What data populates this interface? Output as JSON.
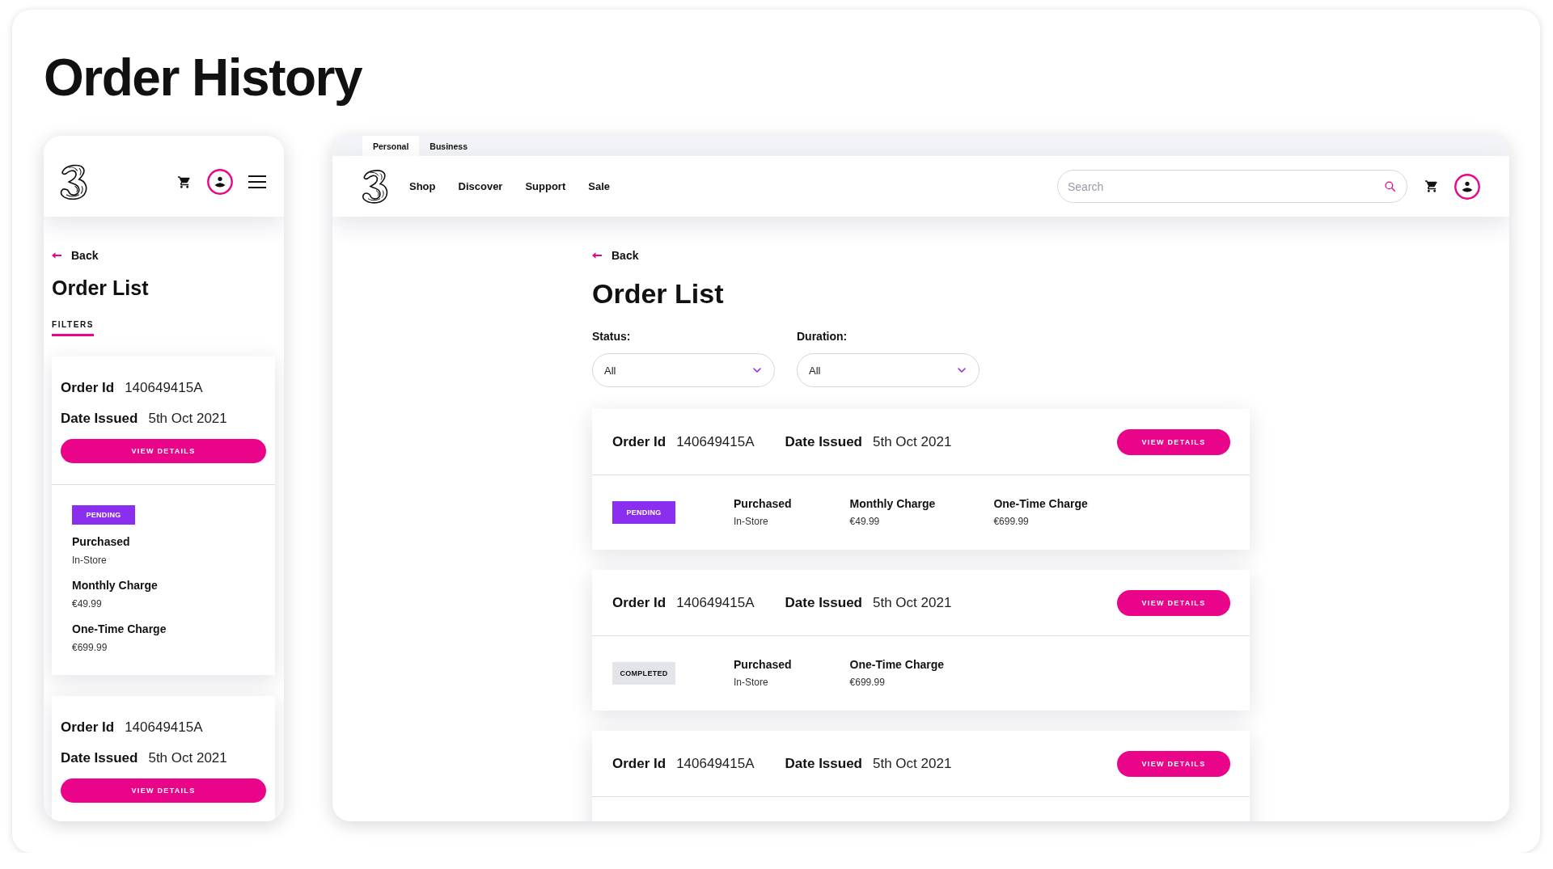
{
  "page_title": "Order History",
  "mobile_view": {
    "back_link": "Back",
    "heading": "Order List",
    "filters_toggle": "FILTERS",
    "orders": [
      {
        "order_id_label": "Order Id",
        "order_id": "140649415A",
        "date_label": "Date Issued",
        "date": "5th Oct 2021",
        "button": "VIEW DETAILS",
        "status": {
          "label": "PENDING",
          "kind": "pending"
        },
        "fields": [
          {
            "label": "Purchased",
            "value": "In-Store"
          },
          {
            "label": "Monthly Charge",
            "value": "€49.99"
          },
          {
            "label": "One-Time Charge",
            "value": "€699.99"
          }
        ]
      },
      {
        "order_id_label": "Order Id",
        "order_id": "140649415A",
        "date_label": "Date Issued",
        "date": "5th Oct 2021",
        "button": "VIEW DETAILS"
      }
    ]
  },
  "desktop_view": {
    "tabs": [
      {
        "label": "Personal",
        "selected": true
      },
      {
        "label": "Business",
        "selected": false
      }
    ],
    "nav_links": [
      "Shop",
      "Discover",
      "Support",
      "Sale"
    ],
    "search": {
      "placeholder": "Search"
    },
    "back_link": "Back",
    "heading": "Order List",
    "filters": [
      {
        "label": "Status:",
        "value": "All"
      },
      {
        "label": "Duration:",
        "value": "All"
      }
    ],
    "orders": [
      {
        "order_id_label": "Order Id",
        "order_id": "140649415A",
        "date_label": "Date Issued",
        "date": "5th Oct 2021",
        "button": "VIEW DETAILS",
        "status": {
          "label": "PENDING",
          "kind": "pending"
        },
        "fields": [
          {
            "label": "Purchased",
            "value": "In-Store"
          },
          {
            "label": "Monthly Charge",
            "value": "€49.99"
          },
          {
            "label": "One-Time Charge",
            "value": "€699.99"
          }
        ]
      },
      {
        "order_id_label": "Order Id",
        "order_id": "140649415A",
        "date_label": "Date Issued",
        "date": "5th Oct 2021",
        "button": "VIEW DETAILS",
        "status": {
          "label": "COMPLETED",
          "kind": "completed"
        },
        "fields": [
          {
            "label": "Purchased",
            "value": "In-Store"
          },
          {
            "label": "One-Time Charge",
            "value": "€699.99"
          }
        ]
      },
      {
        "order_id_label": "Order Id",
        "order_id": "140649415A",
        "date_label": "Date Issued",
        "date": "5th Oct 2021",
        "button": "VIEW DETAILS"
      }
    ]
  }
}
